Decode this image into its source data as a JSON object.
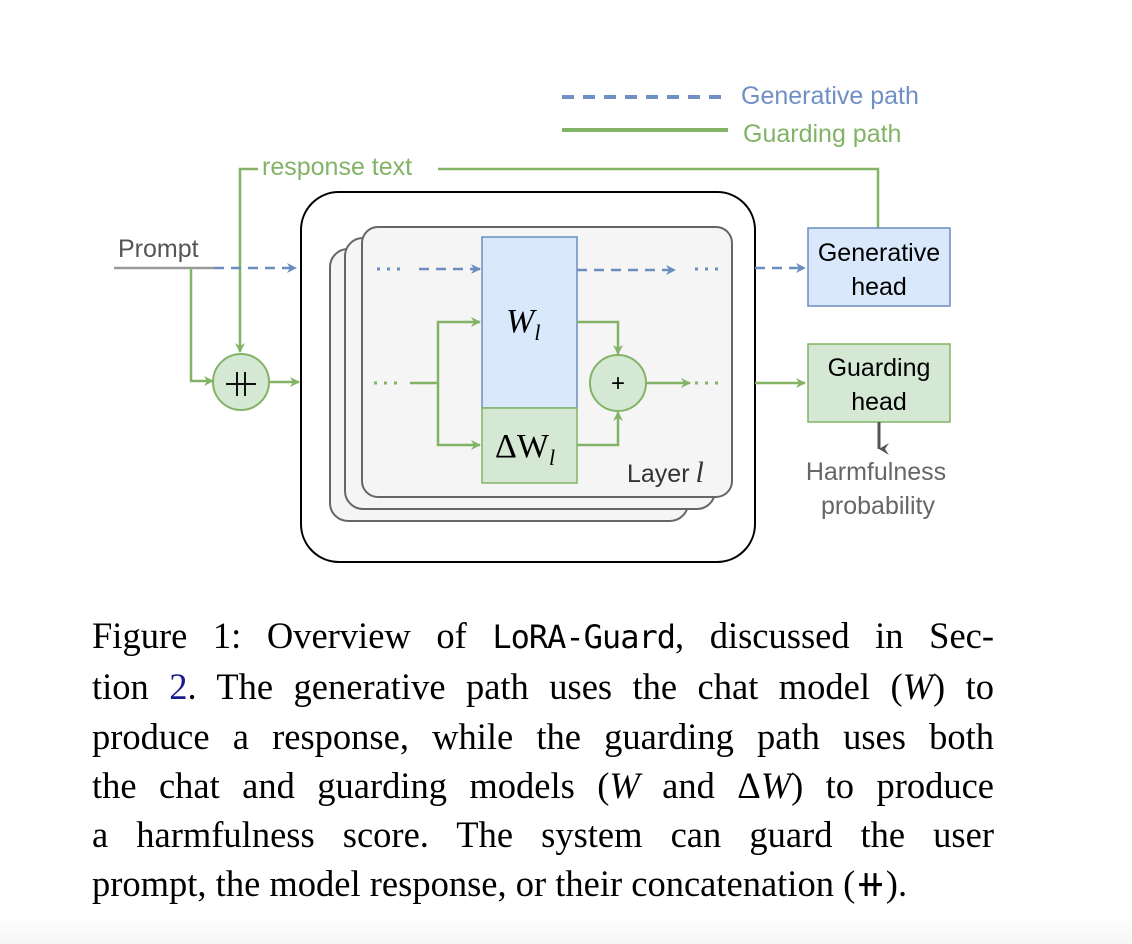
{
  "legend": {
    "generative": {
      "label": "Generative path",
      "color": "#6f8fc5",
      "style": "dashed"
    },
    "guarding": {
      "label": "Guarding path",
      "color": "#82b366",
      "style": "solid"
    }
  },
  "labels": {
    "prompt": "Prompt",
    "response_text": "response text",
    "concat_symbol": "⧺",
    "sum_symbol": "+",
    "ellipsis": "···",
    "weight_main": "W",
    "weight_main_sub": "l",
    "weight_delta": "ΔW",
    "weight_delta_sub": "l",
    "layer_label": "Layer",
    "layer_var": "l",
    "generative_head_line1": "Generative",
    "generative_head_line2": "head",
    "guarding_head_line1": "Guarding",
    "guarding_head_line2": "head",
    "output_line1": "Harmfulness",
    "output_line2": "probability"
  },
  "colors": {
    "blue_fill": "#dae8fc",
    "blue_stroke": "#6c8ebf",
    "green_fill": "#d5e8d4",
    "green_stroke": "#82b366",
    "layer_fill": "#f5f5f5",
    "layer_stroke": "#666666",
    "gray_text": "#666666",
    "prompt_line": "#999999"
  },
  "caption": {
    "l1_a": "Figure 1: Overview of ",
    "l1_code": "LoRA-Guard",
    "l1_b": ", discussed in Sec-",
    "l2_a": "tion ",
    "l2_ref": "2",
    "l2_b": ". The generative path uses the chat model (",
    "l2_w": "W",
    "l2_c": ") to",
    "l3": "produce a response, while the guarding path uses both",
    "l4_a": "the chat and guarding models (",
    "l4_w": "W",
    "l4_b": " and Δ",
    "l4_w2": "W",
    "l4_c": ") to produce",
    "l5": "a harmfulness score.  The system can guard the user",
    "l6": "prompt, the model response, or their concatenation (⧺)."
  }
}
